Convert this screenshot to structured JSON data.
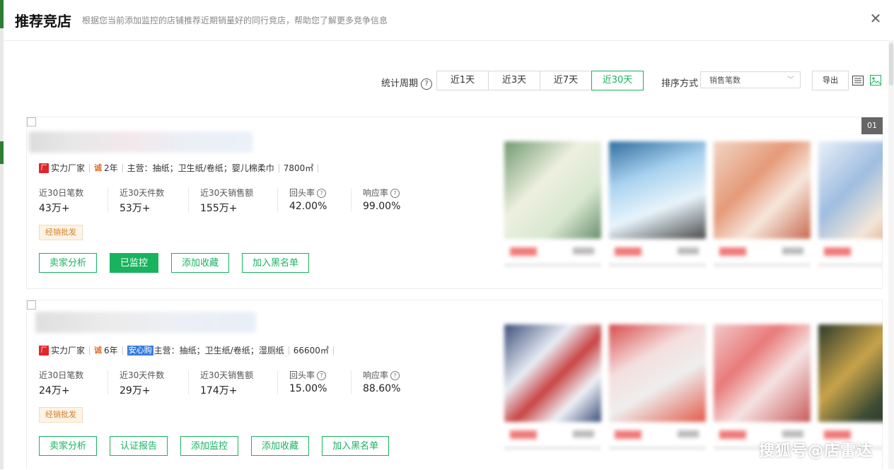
{
  "header": {
    "title": "推荐竞店",
    "subtitle": "根据您当前添加监控的店铺推荐近期销量好的同行竞店，帮助您了解更多竞争信息",
    "close_icon": "close-icon"
  },
  "toolbar": {
    "period_label": "统计周期",
    "periods": [
      "近1天",
      "近3天",
      "近7天",
      "近30天"
    ],
    "active_period": "近30天",
    "sort_label": "排序方式",
    "sort_value": "销售笔数",
    "export_label": "导出",
    "accent_color": "#19b35f"
  },
  "shops": [
    {
      "maker_label": "实力厂家",
      "years": "2年",
      "anxin_badge": "",
      "main_business": "主营：抽纸；卫生纸/卷纸；婴儿棉柔巾",
      "area": "7800㎡",
      "stats": [
        {
          "label": "近30日笔数",
          "value": "43万+"
        },
        {
          "label": "近30天件数",
          "value": "53万+"
        },
        {
          "label": "近30天销售额",
          "value": "155万+"
        },
        {
          "label": "回头率",
          "value": "42.00%"
        },
        {
          "label": "响应率",
          "value": "99.00%"
        }
      ],
      "tag": "经销批发",
      "actions": [
        "卖家分析",
        "已监控",
        "添加收藏",
        "加入黑名单"
      ],
      "rank": "01"
    },
    {
      "maker_label": "实力厂家",
      "years": "6年",
      "anxin_badge": "安心购",
      "main_business": "主营：抽纸；卫生纸/卷纸；湿厕纸",
      "area": "66600㎡",
      "stats": [
        {
          "label": "近30日笔数",
          "value": "24万+"
        },
        {
          "label": "近30天件数",
          "value": "29万+"
        },
        {
          "label": "近30天销售额",
          "value": "174万+"
        },
        {
          "label": "回头率",
          "value": "15.00%"
        },
        {
          "label": "响应率",
          "value": "88.60%"
        }
      ],
      "tag": "经销批发",
      "actions": [
        "卖家分析",
        "认证报告",
        "添加监控",
        "添加收藏",
        "加入黑名单"
      ]
    }
  ],
  "watermark": "搜狐号@店雷达"
}
